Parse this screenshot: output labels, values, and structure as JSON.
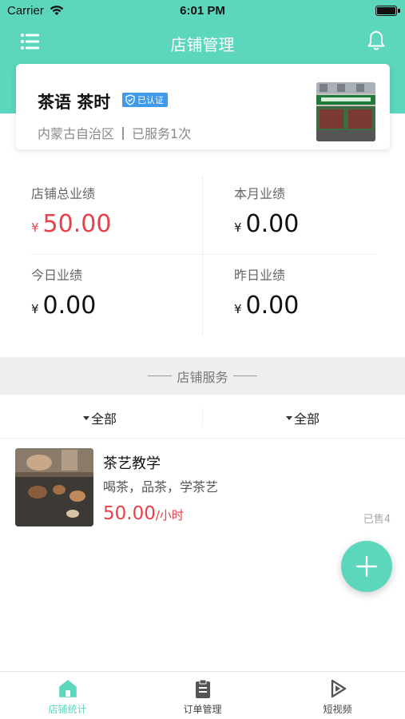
{
  "status_bar": {
    "carrier": "Carrier",
    "time": "6:01 PM"
  },
  "navbar": {
    "title": "店铺管理"
  },
  "store": {
    "name": "茶语 茶时",
    "verified_label": "已认证",
    "region": "内蒙古自治区",
    "served": "已服务1次"
  },
  "stats": {
    "currency": "¥",
    "total": {
      "label": "店铺总业绩",
      "value": "50.00"
    },
    "month": {
      "label": "本月业绩",
      "value": "0.00"
    },
    "today": {
      "label": "今日业绩",
      "value": "0.00"
    },
    "yesterday": {
      "label": "昨日业绩",
      "value": "0.00"
    }
  },
  "section": {
    "title": "店铺服务"
  },
  "filters": {
    "left": "全部",
    "right": "全部"
  },
  "service": {
    "name": "茶艺教学",
    "description": "喝茶，品茶，学茶艺",
    "price": "50.00",
    "unit": "/小时",
    "sold": "已售4"
  },
  "tabs": [
    {
      "label": "店铺统计",
      "icon": "home-icon",
      "active": true
    },
    {
      "label": "订单管理",
      "icon": "clipboard-icon",
      "active": false
    },
    {
      "label": "短视频",
      "icon": "video-play-icon",
      "active": false
    }
  ],
  "colors": {
    "accent": "#5cd6bd",
    "price": "#e8404a",
    "badge": "#3f9ae9"
  }
}
